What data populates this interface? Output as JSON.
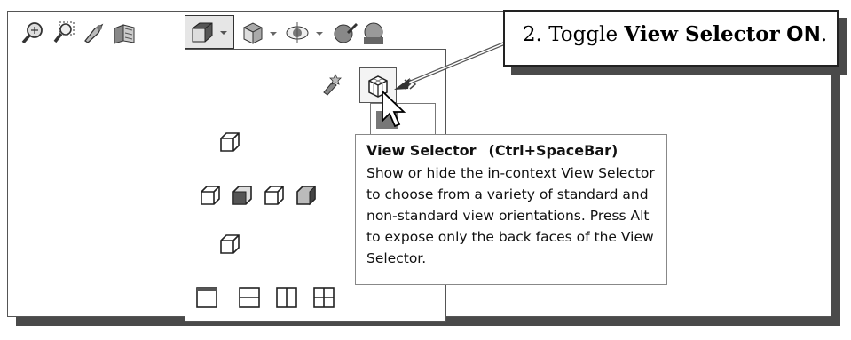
{
  "toolbar": {
    "icons": [
      "zoom-to-fit-icon",
      "zoom-to-area-icon",
      "previous-view-icon",
      "section-view-icon",
      "view-orientation-icon",
      "display-style-icon",
      "hide-show-items-icon",
      "edit-appearance-icon",
      "apply-scene-icon"
    ]
  },
  "flyout": {
    "top_icons": [
      "new-view-icon",
      "view-selector-icon"
    ],
    "view_grid_icons": [
      "top-view-icon",
      "left-view-icon",
      "front-view-icon",
      "right-view-icon",
      "back-view-icon",
      "bottom-view-icon",
      "single-view-icon",
      "two-view-horizontal-icon",
      "two-view-vertical-icon",
      "four-view-icon"
    ]
  },
  "callout": {
    "step_prefix": "2. Toggle ",
    "target_name": "View Selector",
    "state": "ON",
    "suffix": "."
  },
  "tooltip": {
    "title": "View Selector",
    "shortcut": "(Ctrl+SpaceBar)",
    "body": "Show or hide the in-context View Selector to choose from a variety of standard and non-standard view orientations. Press Alt to expose only the back faces of the View Selector."
  }
}
